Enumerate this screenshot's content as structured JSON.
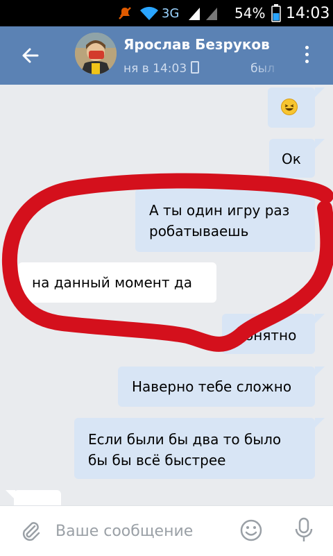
{
  "status_bar": {
    "signal_label": "3G",
    "battery_percent": "54%",
    "time": "14:03",
    "icons": [
      "mute-icon",
      "wifi-icon",
      "signal-icon",
      "battery-icon"
    ]
  },
  "header": {
    "contact_name": "Ярослав Безруков",
    "last_seen_left": "ня в 14:03",
    "last_seen_right": "был"
  },
  "messages": [
    {
      "direction": "out",
      "text": "",
      "emoji": "laughing-emoji"
    },
    {
      "direction": "out",
      "text": "Ок"
    },
    {
      "direction": "out",
      "lines": [
        "А ты один игру раз",
        "робатываешь"
      ]
    },
    {
      "direction": "in",
      "text": "на данный момент да"
    },
    {
      "direction": "out",
      "text": "Понятно"
    },
    {
      "direction": "out",
      "text": "Наверно тебе сложно"
    },
    {
      "direction": "out",
      "lines": [
        "Если были бы два то было",
        "бы бы всё быстрее"
      ]
    }
  ],
  "input_bar": {
    "placeholder": "Ваше сообщение",
    "value": ""
  },
  "colors": {
    "header_bg": "#5b82b4",
    "outgoing_bubble": "#d8e5f5",
    "incoming_bubble": "#ffffff",
    "chat_bg": "#e9ebee",
    "annotation": "#d4101c"
  }
}
